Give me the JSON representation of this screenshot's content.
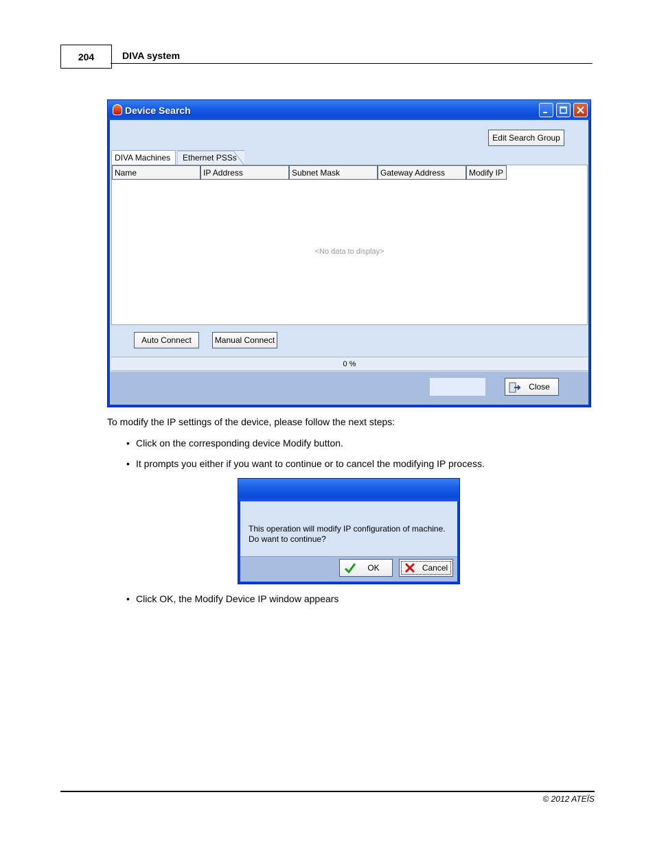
{
  "header": {
    "page_number": "204",
    "title": "DIVA system"
  },
  "device_search": {
    "title": "Device Search",
    "edit_search_group": "Edit Search Group",
    "tabs": [
      "DIVA Machines",
      "Ethernet PSSs"
    ],
    "columns": [
      "Name",
      "IP Address",
      "Subnet Mask",
      "Gateway Address",
      "Modify IP"
    ],
    "empty_text": "<No data to display>",
    "auto_connect": "Auto Connect",
    "manual_connect": "Manual Connect",
    "progress_text": "0 %",
    "progress_value": 0,
    "close": "Close"
  },
  "body": {
    "intro": "To modify the IP settings of the device, please follow the next steps:",
    "bullets": [
      "Click on the corresponding device Modify button.",
      "It prompts you either if you want to continue or to cancel the modifying IP process.",
      "Click OK, the Modify Device IP window appears"
    ]
  },
  "confirm_dialog": {
    "line1": "This operation will modify IP configuration of machine.",
    "line2": "Do want to continue?",
    "ok": "OK",
    "cancel": "Cancel"
  },
  "footer": {
    "copyright": "© 2012 ATEÏS"
  }
}
